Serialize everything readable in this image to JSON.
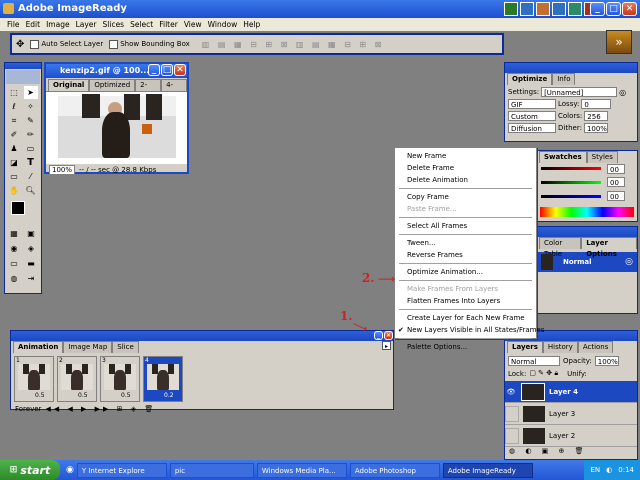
{
  "window": {
    "title": "Adobe ImageReady"
  },
  "menubar": [
    "File",
    "Edit",
    "Image",
    "Layer",
    "Slices",
    "Select",
    "Filter",
    "View",
    "Window",
    "Help"
  ],
  "options_bar": {
    "auto_select_layer": "Auto Select Layer",
    "show_bounding_box": "Show Bounding Box"
  },
  "doc": {
    "title": "kenzip2.gif @ 100...",
    "tabs": [
      "Original",
      "Optimized",
      "2-Up",
      "4-Up"
    ],
    "zoom": "100%",
    "status": "-- / -- sec @ 28.8 Kbps"
  },
  "optimize": {
    "tabs": [
      "Optimize",
      "Info"
    ],
    "settings_label": "Settings:",
    "settings_value": "[Unnamed]",
    "format": "GIF",
    "lossy_label": "Lossy:",
    "lossy_value": "0",
    "palette": "Custom",
    "colors_label": "Colors:",
    "colors_value": "256",
    "dither_type": "Diffusion",
    "dither_label": "Dither:",
    "dither_value": "100%"
  },
  "color_palette": {
    "tabs": [
      "Swatches",
      "Styles"
    ],
    "values": [
      "00",
      "00",
      "00"
    ]
  },
  "layer_options": {
    "tabs": [
      "Color Table",
      "Layer Options"
    ],
    "mode": "Normal"
  },
  "context_menu": {
    "items": [
      {
        "label": "New Frame",
        "disabled": false
      },
      {
        "label": "Delete Frame",
        "disabled": false
      },
      {
        "label": "Delete Animation",
        "disabled": false
      },
      {
        "sep": true
      },
      {
        "label": "Copy Frame",
        "disabled": false
      },
      {
        "label": "Paste Frame...",
        "disabled": true
      },
      {
        "sep": true
      },
      {
        "label": "Select All Frames",
        "disabled": false
      },
      {
        "sep": true
      },
      {
        "label": "Tween...",
        "disabled": false
      },
      {
        "label": "Reverse Frames",
        "disabled": false
      },
      {
        "sep": true
      },
      {
        "label": "Optimize Animation...",
        "disabled": false
      },
      {
        "sep": true
      },
      {
        "label": "Make Frames From Layers",
        "disabled": true
      },
      {
        "label": "Flatten Frames Into Layers",
        "disabled": false
      },
      {
        "sep": true
      },
      {
        "label": "Create Layer for Each New Frame",
        "disabled": false
      },
      {
        "label": "New Layers Visible in All States/Frames",
        "disabled": false,
        "checked": true
      },
      {
        "sep": true
      },
      {
        "label": "Palette Options...",
        "disabled": false
      }
    ]
  },
  "annotations": {
    "one": "1.",
    "two": "2."
  },
  "animation": {
    "tabs": [
      "Animation",
      "Image Map",
      "Slice"
    ],
    "frames": [
      {
        "num": "1",
        "delay": "0.5"
      },
      {
        "num": "2",
        "delay": "0.5"
      },
      {
        "num": "3",
        "delay": "0.5"
      },
      {
        "num": "4",
        "delay": "0.2"
      }
    ],
    "loop": "Forever"
  },
  "layers": {
    "tabs": [
      "Layers",
      "History",
      "Actions"
    ],
    "blend": "Normal",
    "opacity_label": "Opacity:",
    "opacity_value": "100%",
    "lock_label": "Lock:",
    "unify_label": "Unify:",
    "items": [
      "Layer 4",
      "Layer 3",
      "Layer 2"
    ]
  },
  "taskbar": {
    "start": "start",
    "buttons": [
      "Y Internet Explore",
      "pic",
      "Windows Media Pla...",
      "Adobe Photoshop",
      "Adobe ImageReady"
    ],
    "lang": "EN",
    "clock": "0:14"
  }
}
